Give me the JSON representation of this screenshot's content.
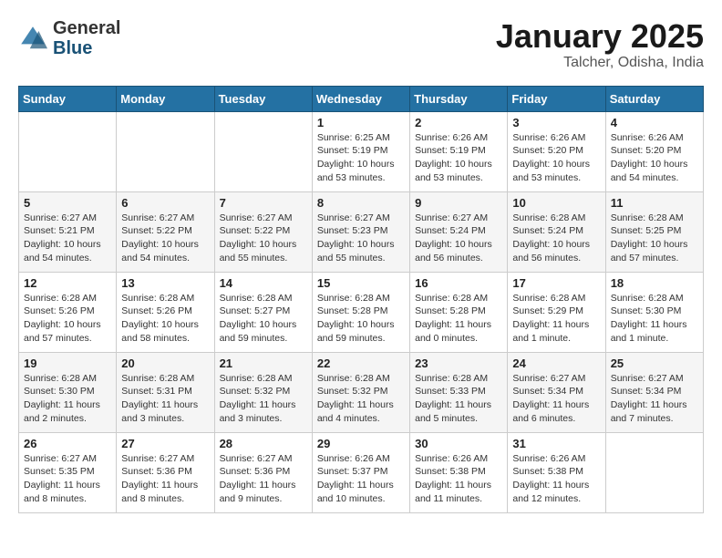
{
  "header": {
    "logo_general": "General",
    "logo_blue": "Blue",
    "title": "January 2025",
    "location": "Talcher, Odisha, India"
  },
  "weekdays": [
    "Sunday",
    "Monday",
    "Tuesday",
    "Wednesday",
    "Thursday",
    "Friday",
    "Saturday"
  ],
  "weeks": [
    [
      {
        "day": "",
        "info": ""
      },
      {
        "day": "",
        "info": ""
      },
      {
        "day": "",
        "info": ""
      },
      {
        "day": "1",
        "info": "Sunrise: 6:25 AM\nSunset: 5:19 PM\nDaylight: 10 hours\nand 53 minutes."
      },
      {
        "day": "2",
        "info": "Sunrise: 6:26 AM\nSunset: 5:19 PM\nDaylight: 10 hours\nand 53 minutes."
      },
      {
        "day": "3",
        "info": "Sunrise: 6:26 AM\nSunset: 5:20 PM\nDaylight: 10 hours\nand 53 minutes."
      },
      {
        "day": "4",
        "info": "Sunrise: 6:26 AM\nSunset: 5:20 PM\nDaylight: 10 hours\nand 54 minutes."
      }
    ],
    [
      {
        "day": "5",
        "info": "Sunrise: 6:27 AM\nSunset: 5:21 PM\nDaylight: 10 hours\nand 54 minutes."
      },
      {
        "day": "6",
        "info": "Sunrise: 6:27 AM\nSunset: 5:22 PM\nDaylight: 10 hours\nand 54 minutes."
      },
      {
        "day": "7",
        "info": "Sunrise: 6:27 AM\nSunset: 5:22 PM\nDaylight: 10 hours\nand 55 minutes."
      },
      {
        "day": "8",
        "info": "Sunrise: 6:27 AM\nSunset: 5:23 PM\nDaylight: 10 hours\nand 55 minutes."
      },
      {
        "day": "9",
        "info": "Sunrise: 6:27 AM\nSunset: 5:24 PM\nDaylight: 10 hours\nand 56 minutes."
      },
      {
        "day": "10",
        "info": "Sunrise: 6:28 AM\nSunset: 5:24 PM\nDaylight: 10 hours\nand 56 minutes."
      },
      {
        "day": "11",
        "info": "Sunrise: 6:28 AM\nSunset: 5:25 PM\nDaylight: 10 hours\nand 57 minutes."
      }
    ],
    [
      {
        "day": "12",
        "info": "Sunrise: 6:28 AM\nSunset: 5:26 PM\nDaylight: 10 hours\nand 57 minutes."
      },
      {
        "day": "13",
        "info": "Sunrise: 6:28 AM\nSunset: 5:26 PM\nDaylight: 10 hours\nand 58 minutes."
      },
      {
        "day": "14",
        "info": "Sunrise: 6:28 AM\nSunset: 5:27 PM\nDaylight: 10 hours\nand 59 minutes."
      },
      {
        "day": "15",
        "info": "Sunrise: 6:28 AM\nSunset: 5:28 PM\nDaylight: 10 hours\nand 59 minutes."
      },
      {
        "day": "16",
        "info": "Sunrise: 6:28 AM\nSunset: 5:28 PM\nDaylight: 11 hours\nand 0 minutes."
      },
      {
        "day": "17",
        "info": "Sunrise: 6:28 AM\nSunset: 5:29 PM\nDaylight: 11 hours\nand 1 minute."
      },
      {
        "day": "18",
        "info": "Sunrise: 6:28 AM\nSunset: 5:30 PM\nDaylight: 11 hours\nand 1 minute."
      }
    ],
    [
      {
        "day": "19",
        "info": "Sunrise: 6:28 AM\nSunset: 5:30 PM\nDaylight: 11 hours\nand 2 minutes."
      },
      {
        "day": "20",
        "info": "Sunrise: 6:28 AM\nSunset: 5:31 PM\nDaylight: 11 hours\nand 3 minutes."
      },
      {
        "day": "21",
        "info": "Sunrise: 6:28 AM\nSunset: 5:32 PM\nDaylight: 11 hours\nand 3 minutes."
      },
      {
        "day": "22",
        "info": "Sunrise: 6:28 AM\nSunset: 5:32 PM\nDaylight: 11 hours\nand 4 minutes."
      },
      {
        "day": "23",
        "info": "Sunrise: 6:28 AM\nSunset: 5:33 PM\nDaylight: 11 hours\nand 5 minutes."
      },
      {
        "day": "24",
        "info": "Sunrise: 6:27 AM\nSunset: 5:34 PM\nDaylight: 11 hours\nand 6 minutes."
      },
      {
        "day": "25",
        "info": "Sunrise: 6:27 AM\nSunset: 5:34 PM\nDaylight: 11 hours\nand 7 minutes."
      }
    ],
    [
      {
        "day": "26",
        "info": "Sunrise: 6:27 AM\nSunset: 5:35 PM\nDaylight: 11 hours\nand 8 minutes."
      },
      {
        "day": "27",
        "info": "Sunrise: 6:27 AM\nSunset: 5:36 PM\nDaylight: 11 hours\nand 8 minutes."
      },
      {
        "day": "28",
        "info": "Sunrise: 6:27 AM\nSunset: 5:36 PM\nDaylight: 11 hours\nand 9 minutes."
      },
      {
        "day": "29",
        "info": "Sunrise: 6:26 AM\nSunset: 5:37 PM\nDaylight: 11 hours\nand 10 minutes."
      },
      {
        "day": "30",
        "info": "Sunrise: 6:26 AM\nSunset: 5:38 PM\nDaylight: 11 hours\nand 11 minutes."
      },
      {
        "day": "31",
        "info": "Sunrise: 6:26 AM\nSunset: 5:38 PM\nDaylight: 11 hours\nand 12 minutes."
      },
      {
        "day": "",
        "info": ""
      }
    ]
  ]
}
